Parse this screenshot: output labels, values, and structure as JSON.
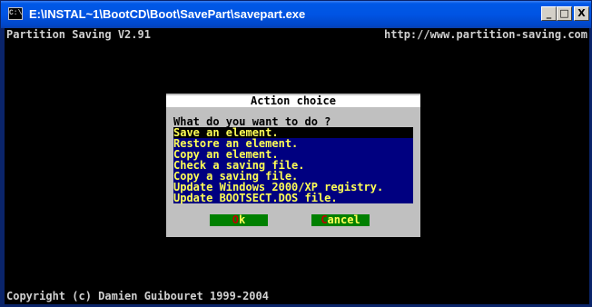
{
  "window": {
    "title": "E:\\INSTAL~1\\BootCD\\Boot\\SavePart\\savepart.exe",
    "icon": "console-icon",
    "icon_text": "C:\\",
    "min_glyph": "_",
    "max_glyph": "□",
    "close_glyph": "X"
  },
  "console": {
    "app_name": "Partition Saving V2.91",
    "url": "http://www.partition-saving.com",
    "copyright": "Copyright (c) Damien Guibouret 1999-2004"
  },
  "dialog": {
    "title": "Action choice",
    "question": "What do you want to do ?",
    "items": [
      {
        "label": "Save an element."
      },
      {
        "label": "Restore an element."
      },
      {
        "label": "Copy an element."
      },
      {
        "label": "Check a saving file."
      },
      {
        "label": "Copy a saving file."
      },
      {
        "label": "Update Windows 2000/XP registry."
      },
      {
        "label": "Update BOOTSECT.DOS file."
      }
    ],
    "selected_index": 0,
    "ok_hotkey": "O",
    "ok_rest": "k",
    "cancel_hotkey": "C",
    "cancel_rest": "ancel"
  },
  "colors": {
    "dialog_bg": "#c0c0c0",
    "list_bg": "#000080",
    "item_text": "#ffff55",
    "button_bg": "#008000",
    "hotkey": "#c00000"
  }
}
